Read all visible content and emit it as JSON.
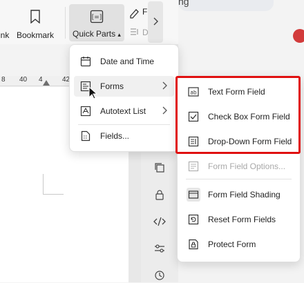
{
  "ribbon": {
    "link_label": "nk",
    "bookmark_label": "Bookmark",
    "quick_parts_label": "Quick Parts",
    "partial_label_1": "F",
    "partial_label_2": "D"
  },
  "header_partial_text": "ng",
  "ruler": {
    "ticks": [
      "8",
      "40",
      "42",
      "4"
    ]
  },
  "quick_parts_menu": {
    "items": [
      {
        "label": "Date and Time",
        "icon": "calendar-icon"
      },
      {
        "label": "Forms",
        "icon": "form-icon",
        "submenu": true
      },
      {
        "label": "Autotext List",
        "icon": "autotext-icon",
        "submenu": true
      },
      {
        "label": "Fields...",
        "icon": "document-field-icon"
      }
    ]
  },
  "forms_menu": {
    "items": [
      {
        "label": "Text Form Field",
        "icon": "text-field-icon"
      },
      {
        "label": "Check Box Form Field",
        "icon": "checkbox-icon"
      },
      {
        "label": "Drop-Down Form Field",
        "icon": "dropdown-field-icon"
      },
      {
        "label": "Form Field Options...",
        "icon": "field-options-icon",
        "disabled": true
      },
      {
        "label": "Form Field Shading",
        "icon": "shading-icon"
      },
      {
        "label": "Reset Form Fields",
        "icon": "reset-icon"
      },
      {
        "label": "Protect Form",
        "icon": "protect-form-icon"
      }
    ]
  },
  "colors": {
    "highlight": "#e01010",
    "accent": "#1e1e1e"
  }
}
